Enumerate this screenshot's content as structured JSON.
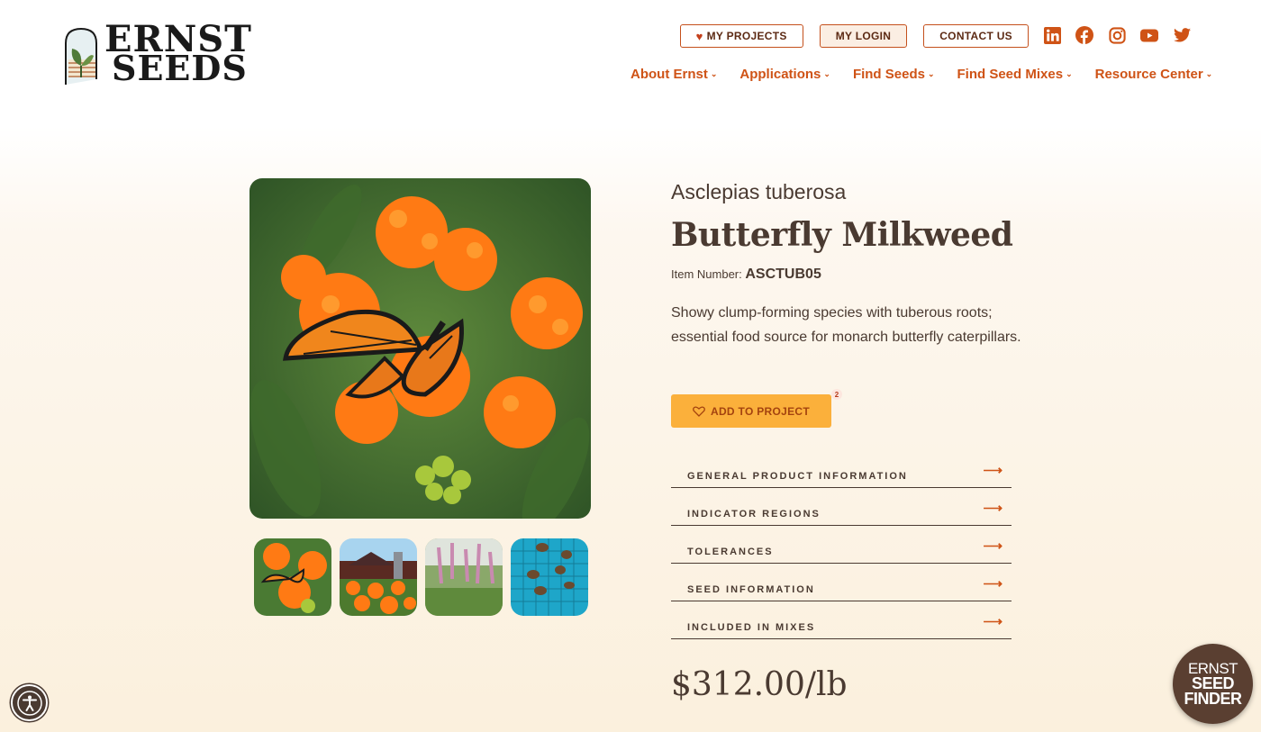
{
  "logo": {
    "line1": "ERNST",
    "line2": "SEEDS"
  },
  "top_buttons": {
    "projects": "MY PROJECTS",
    "login": "MY LOGIN",
    "contact": "CONTACT US"
  },
  "socials": [
    "linkedin-icon",
    "facebook-icon",
    "instagram-icon",
    "youtube-icon",
    "twitter-icon"
  ],
  "nav": [
    "About Ernst",
    "Applications",
    "Find Seeds",
    "Find Seed Mixes",
    "Resource Center"
  ],
  "product": {
    "scientific_name": "Asclepias tuberosa",
    "common_name": "Butterfly Milkweed",
    "item_number_label": "Item Number:",
    "item_number": "ASCTUB05",
    "description": "Showy clump-forming species with tuberous roots; essential food source for monarch butterfly caterpillars.",
    "add_button": "ADD TO PROJECT",
    "project_count": "2",
    "price": "$312.00/lb"
  },
  "accordion": [
    "GENERAL PRODUCT INFORMATION",
    "INDICATOR REGIONS",
    "TOLERANCES",
    "SEED INFORMATION",
    "INCLUDED IN MIXES"
  ],
  "finder": {
    "line1": "ERNST",
    "line2": "SEED",
    "line3": "FINDER"
  },
  "colors": {
    "accent": "#cf5316",
    "button": "#fbb03b",
    "text": "#4a3a31"
  }
}
